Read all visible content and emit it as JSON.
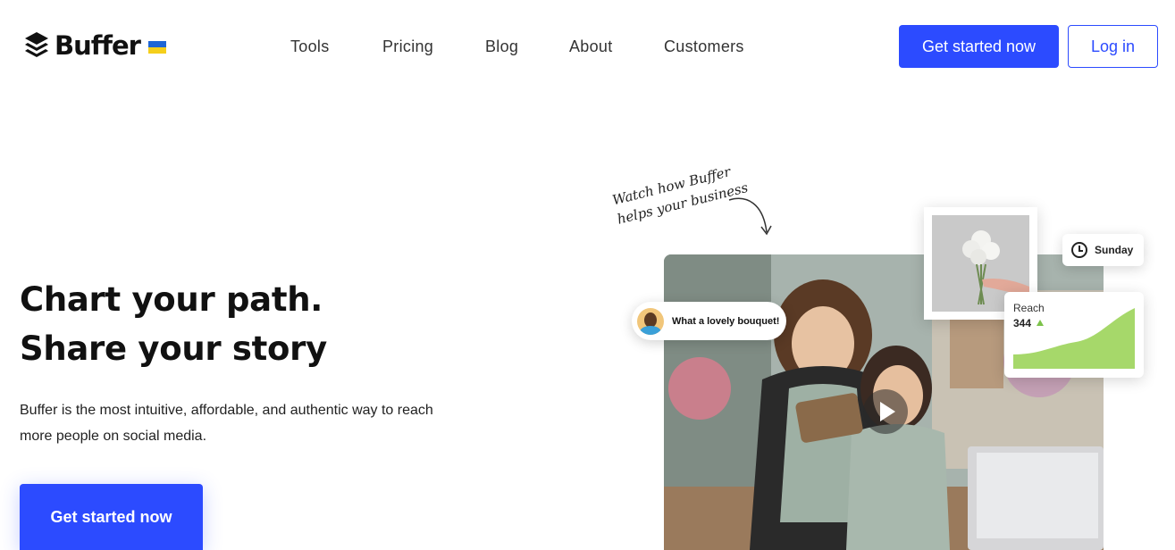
{
  "header": {
    "brand": "Buffer",
    "nav": [
      "Tools",
      "Pricing",
      "Blog",
      "About",
      "Customers"
    ],
    "cta_label": "Get started now",
    "login_label": "Log in"
  },
  "hero": {
    "headline_line1": "Chart your path.",
    "headline_line2": "Share your story",
    "subtext": "Buffer is the most intuitive, affordable, and authentic way to reach more people on social media.",
    "cta_label": "Get started now"
  },
  "media": {
    "handwritten_line1": "Watch how Buffer",
    "handwritten_line2": "helps your business",
    "comment_text": "What a lovely bouquet!",
    "schedule_day": "Sunday",
    "reach_label": "Reach",
    "reach_value": "344"
  },
  "colors": {
    "brand_blue": "#2c4bff",
    "flag_blue": "#1f66d6",
    "flag_yellow": "#f5cf1b",
    "reach_green": "#a6d86a"
  },
  "icons": [
    "buffer-logo-icon",
    "ukraine-flag-icon",
    "curved-arrow-icon",
    "play-icon",
    "clock-icon",
    "trend-up-icon",
    "avatar"
  ]
}
